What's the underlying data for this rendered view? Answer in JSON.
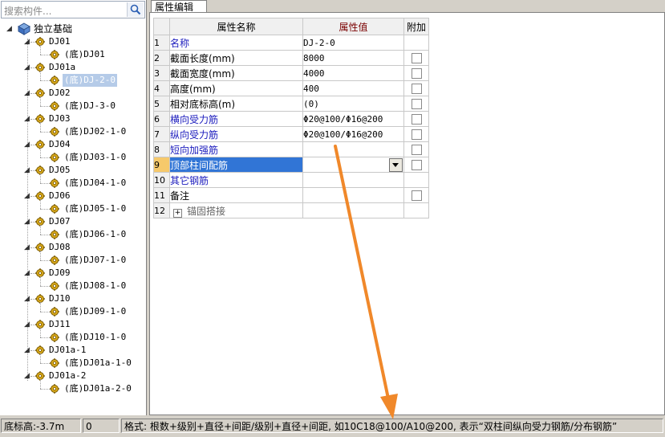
{
  "search": {
    "placeholder": "搜索构件..."
  },
  "tree": {
    "root": "独立基础",
    "items": [
      {
        "label": "DJ01",
        "child": "(底)DJ01"
      },
      {
        "label": "DJ01a",
        "child": "(底)DJ-2-0"
      },
      {
        "label": "DJ02",
        "child": "(底)DJ-3-0"
      },
      {
        "label": "DJ03",
        "child": "(底)DJ02-1-0"
      },
      {
        "label": "DJ04",
        "child": "(底)DJ03-1-0"
      },
      {
        "label": "DJ05",
        "child": "(底)DJ04-1-0"
      },
      {
        "label": "DJ06",
        "child": "(底)DJ05-1-0"
      },
      {
        "label": "DJ07",
        "child": "(底)DJ06-1-0"
      },
      {
        "label": "DJ08",
        "child": "(底)DJ07-1-0"
      },
      {
        "label": "DJ09",
        "child": "(底)DJ08-1-0"
      },
      {
        "label": "DJ10",
        "child": "(底)DJ09-1-0"
      },
      {
        "label": "DJ11",
        "child": "(底)DJ10-1-0"
      },
      {
        "label": "DJ01a-1",
        "child": "(底)DJ01a-1-0"
      },
      {
        "label": "DJ01a-2",
        "child": "(底)DJ01a-2-0"
      }
    ]
  },
  "tab": {
    "label": "属性编辑"
  },
  "grid": {
    "headers": [
      "属性名称",
      "属性值",
      "附加"
    ],
    "rows": [
      {
        "num": "1",
        "name": "名称",
        "value": "DJ-2-0",
        "check": false,
        "color": "blue"
      },
      {
        "num": "2",
        "name": "截面长度(mm)",
        "value": "8000",
        "check": true,
        "color": "black"
      },
      {
        "num": "3",
        "name": "截面宽度(mm)",
        "value": "4000",
        "check": true,
        "color": "black"
      },
      {
        "num": "4",
        "name": "高度(mm)",
        "value": "400",
        "check": true,
        "color": "black"
      },
      {
        "num": "5",
        "name": "相对底标高(m)",
        "value": "(0)",
        "check": true,
        "color": "black"
      },
      {
        "num": "6",
        "name": "横向受力筋",
        "value": "Φ20@100/Φ16@200",
        "check": true,
        "color": "blue"
      },
      {
        "num": "7",
        "name": "纵向受力筋",
        "value": "Φ20@100/Φ16@200",
        "check": true,
        "color": "blue"
      },
      {
        "num": "8",
        "name": "短向加强筋",
        "value": "",
        "check": true,
        "color": "blue"
      },
      {
        "num": "9",
        "name": "顶部柱间配筋",
        "value": "",
        "check": true,
        "color": "blue"
      },
      {
        "num": "10",
        "name": "其它钢筋",
        "value": "",
        "check": false,
        "color": "blue"
      },
      {
        "num": "11",
        "name": "备注",
        "value": "",
        "check": true,
        "color": "black"
      },
      {
        "num": "12",
        "name": "锚固搭接",
        "value": "",
        "check": false,
        "color": "gray"
      }
    ]
  },
  "status": {
    "elevation": "底标高:-3.7m",
    "count": "0",
    "hint": "格式: 根数+级别+直径+间距/级别+直径+间距, 如10C18@100/A10@200, 表示“双柱间纵向受力钢筋/分布钢筋”"
  }
}
